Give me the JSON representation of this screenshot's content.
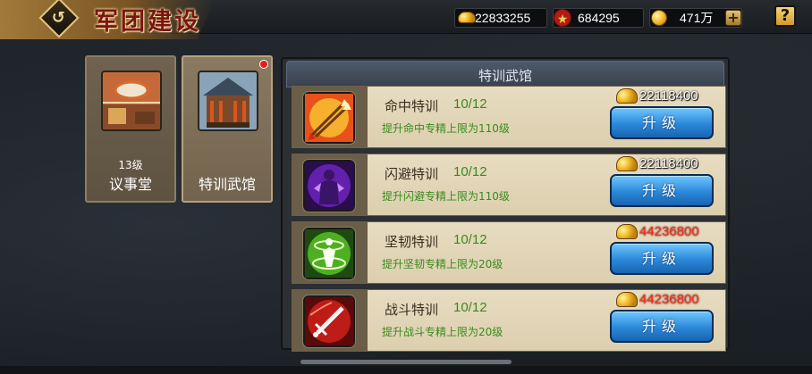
{
  "header": {
    "title": "军团建设",
    "back_icon": "back-arrow-icon"
  },
  "resources": {
    "gold": "22833255",
    "honor": "684295",
    "yuanbao": "471万",
    "add_label": "+",
    "help_label": "?"
  },
  "buildings": [
    {
      "level": "13级",
      "name": "议事堂",
      "selected": false
    },
    {
      "level": "",
      "name": "特训武馆",
      "selected": true,
      "has_notification": true
    }
  ],
  "panel": {
    "title": "特训武馆",
    "rows": [
      {
        "name": "命中特训",
        "progress": "10/12",
        "desc": "提升命中专精上限为110级",
        "cost": "22118400",
        "cost_sufficient": true,
        "button": "升级",
        "icon": "arrows-icon"
      },
      {
        "name": "闪避特训",
        "progress": "10/12",
        "desc": "提升闪避专精上限为110级",
        "cost": "22118400",
        "cost_sufficient": true,
        "button": "升级",
        "icon": "shadow-figure-icon"
      },
      {
        "name": "坚韧特训",
        "progress": "10/12",
        "desc": "提升坚韧专精上限为20级",
        "cost": "44236800",
        "cost_sufficient": false,
        "button": "升级",
        "icon": "shield-aura-icon"
      },
      {
        "name": "战斗特训",
        "progress": "10/12",
        "desc": "提升战斗专精上限为20级",
        "cost": "44236800",
        "cost_sufficient": false,
        "button": "升级",
        "icon": "sword-icon"
      }
    ]
  },
  "colors": {
    "accent_green": "#3a8a1c",
    "insufficient_red": "#ff2a1c",
    "button_blue": "#2b88d8"
  }
}
